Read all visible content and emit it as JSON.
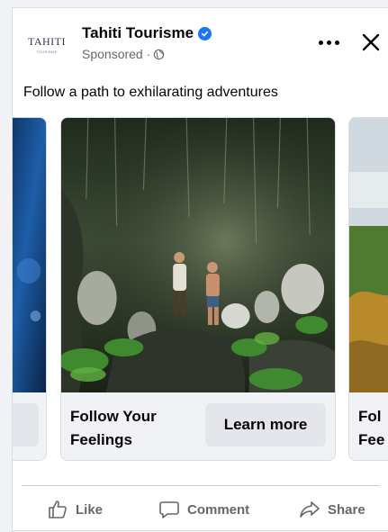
{
  "post": {
    "page_name": "Tahiti Tourisme",
    "sponsored_label": "Sponsored ·",
    "caption": "Follow a path to exhilarating adventures",
    "logo": {
      "word": "TAHITI",
      "sub": "TOURISME"
    }
  },
  "carousel": {
    "main_card": {
      "title": "Follow Your Feelings",
      "cta_label": "Learn more"
    },
    "next_card": {
      "title_partial": "Fol Fee"
    }
  },
  "actions": {
    "like": "Like",
    "comment": "Comment",
    "share": "Share"
  },
  "colors": {
    "verified": "#1877f2",
    "cta_bg": "#e4e6eb",
    "muted_text": "#65676b"
  }
}
